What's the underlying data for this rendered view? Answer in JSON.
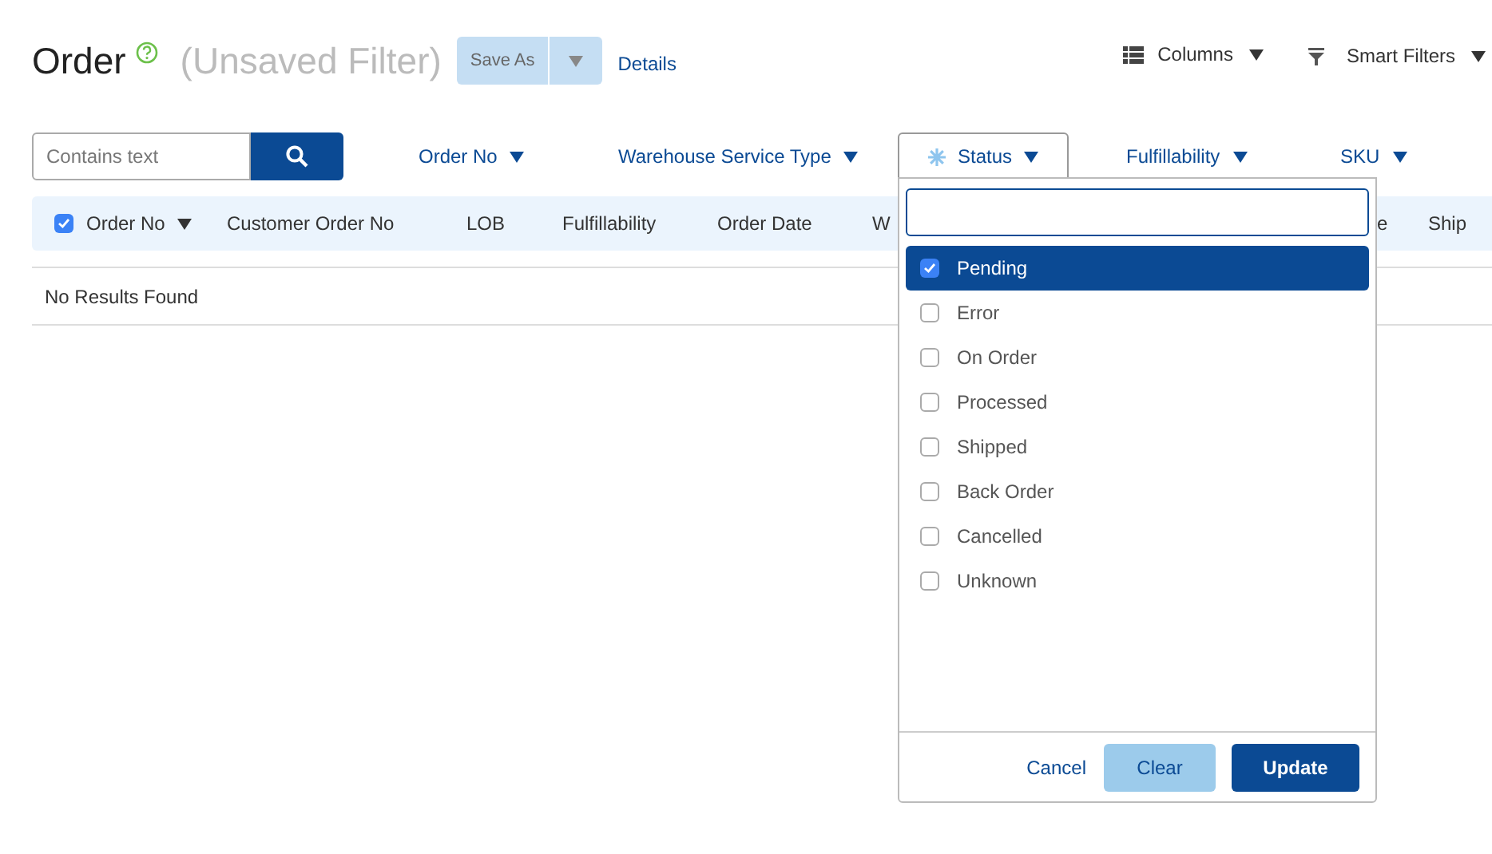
{
  "header": {
    "title": "Order",
    "filter_name": "(Unsaved Filter)",
    "save_as": "Save As",
    "details": "Details",
    "columns_menu": "Columns",
    "smart_filters": "Smart Filters"
  },
  "search": {
    "placeholder": "Contains text"
  },
  "filters": [
    {
      "label": "Order No",
      "open": false
    },
    {
      "label": "Warehouse Service Type",
      "open": false
    },
    {
      "label": "Status",
      "open": true
    },
    {
      "label": "Fulfillability",
      "open": false
    },
    {
      "label": "SKU",
      "open": false
    }
  ],
  "table": {
    "select_all_checked": true,
    "columns": [
      {
        "label": "Order No",
        "sorted": true
      },
      {
        "label": "Customer Order No"
      },
      {
        "label": "LOB"
      },
      {
        "label": "Fulfillability"
      },
      {
        "label": "Order Date"
      },
      {
        "label": "W"
      },
      {
        "label": "e"
      },
      {
        "label": "Ship"
      }
    ],
    "empty_message": "No Results Found"
  },
  "status_dropdown": {
    "options": [
      {
        "label": "Pending",
        "checked": true,
        "selected": true
      },
      {
        "label": "Error",
        "checked": false,
        "selected": false
      },
      {
        "label": "On Order",
        "checked": false,
        "selected": false
      },
      {
        "label": "Processed",
        "checked": false,
        "selected": false
      },
      {
        "label": "Shipped",
        "checked": false,
        "selected": false
      },
      {
        "label": "Back Order",
        "checked": false,
        "selected": false
      },
      {
        "label": "Cancelled",
        "checked": false,
        "selected": false
      },
      {
        "label": "Unknown",
        "checked": false,
        "selected": false
      }
    ],
    "cancel": "Cancel",
    "clear": "Clear",
    "update": "Update"
  }
}
